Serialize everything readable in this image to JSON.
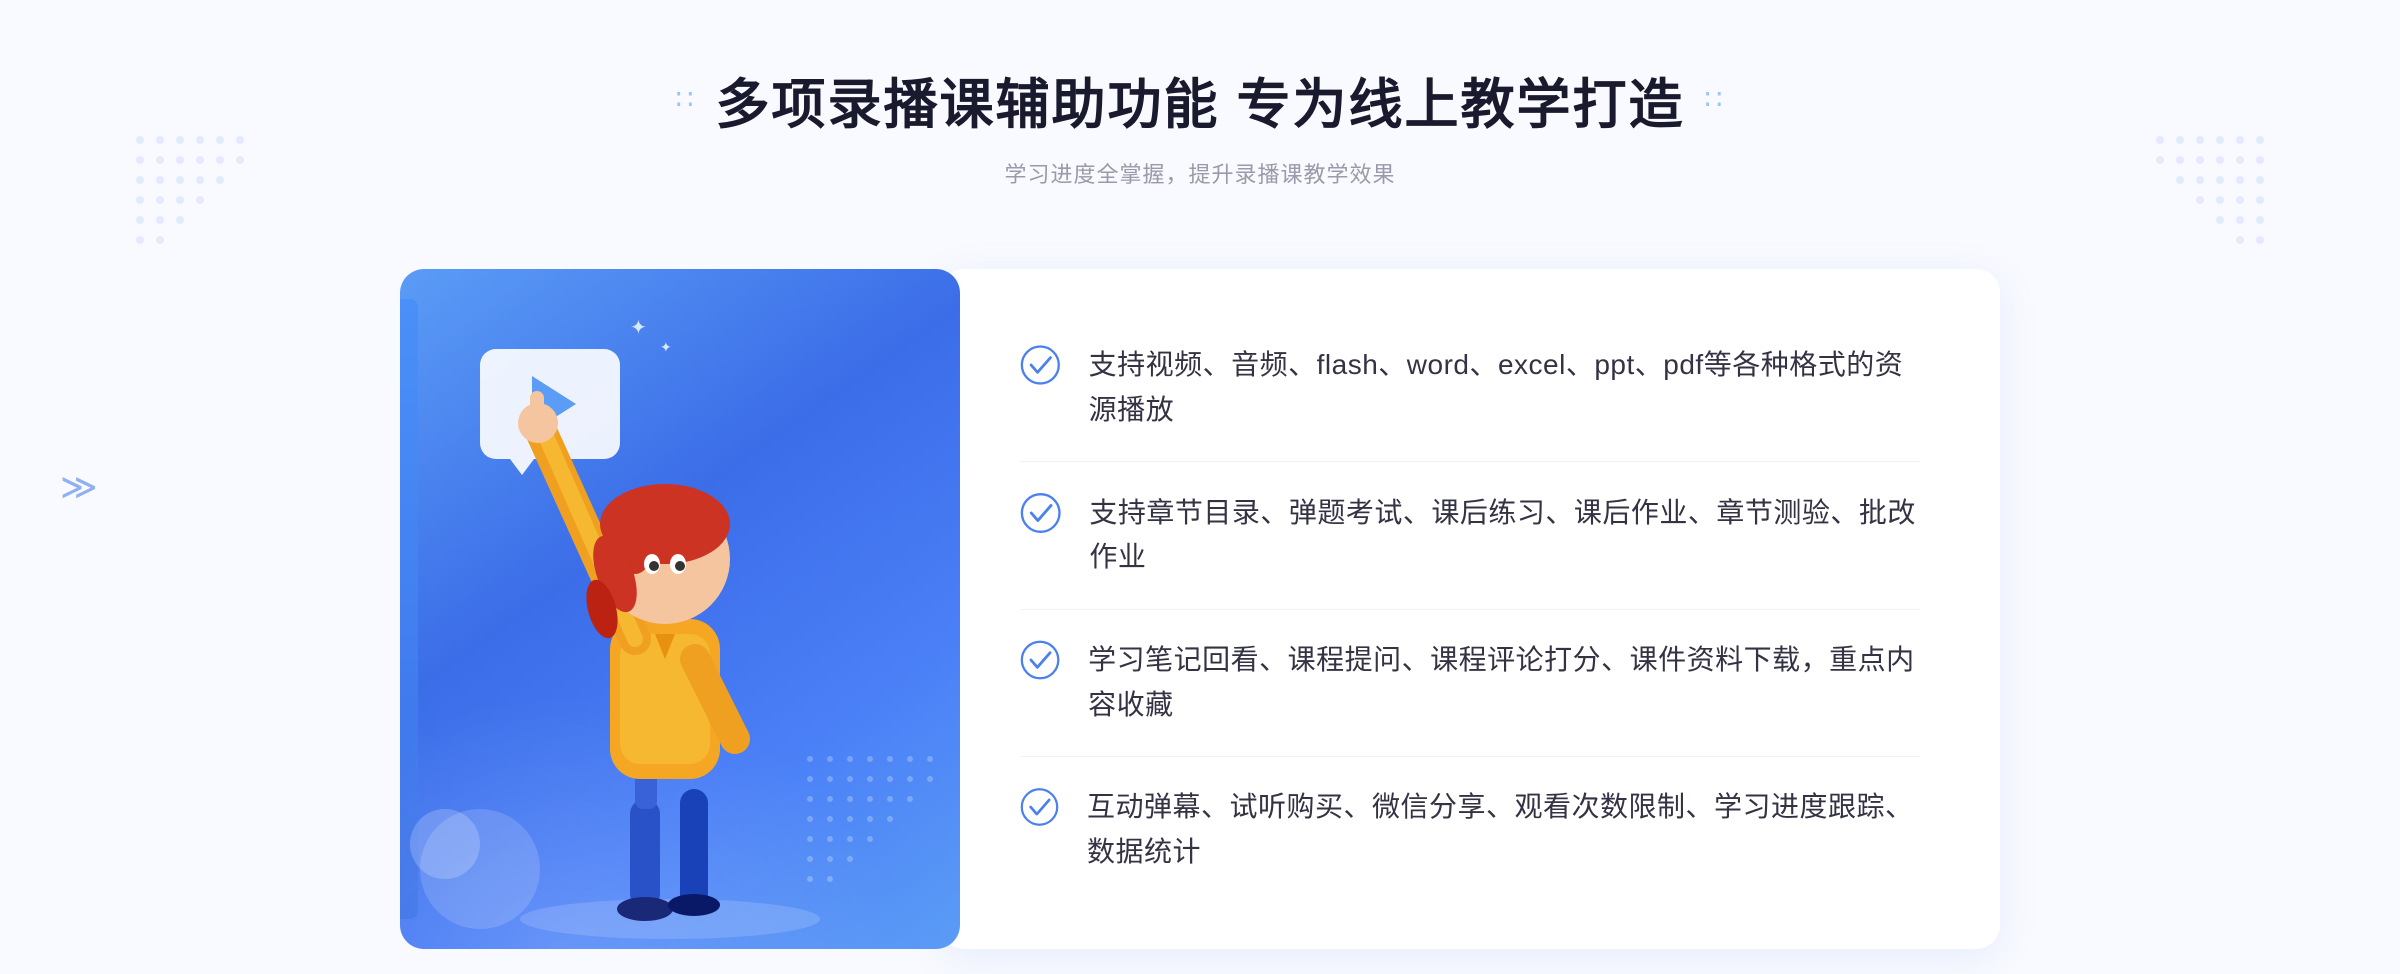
{
  "header": {
    "title": "多项录播课辅助功能 专为线上教学打造",
    "subtitle": "学习进度全掌握，提升录播课教学效果",
    "title_dots_left": "∷",
    "title_dots_right": "∷"
  },
  "features": [
    {
      "id": 1,
      "text": "支持视频、音频、flash、word、excel、ppt、pdf等各种格式的资源播放"
    },
    {
      "id": 2,
      "text": "支持章节目录、弹题考试、课后练习、课后作业、章节测验、批改作业"
    },
    {
      "id": 3,
      "text": "学习笔记回看、课程提问、课程评论打分、课件资料下载，重点内容收藏"
    },
    {
      "id": 4,
      "text": "互动弹幕、试听购买、微信分享、观看次数限制、学习进度跟踪、数据统计"
    }
  ],
  "colors": {
    "primary_blue": "#4a80f0",
    "light_blue": "#5b9cf6",
    "dark_blue": "#3b6de8",
    "text_dark": "#333344",
    "text_subtitle": "#999aaa",
    "check_color": "#4a80f0"
  }
}
